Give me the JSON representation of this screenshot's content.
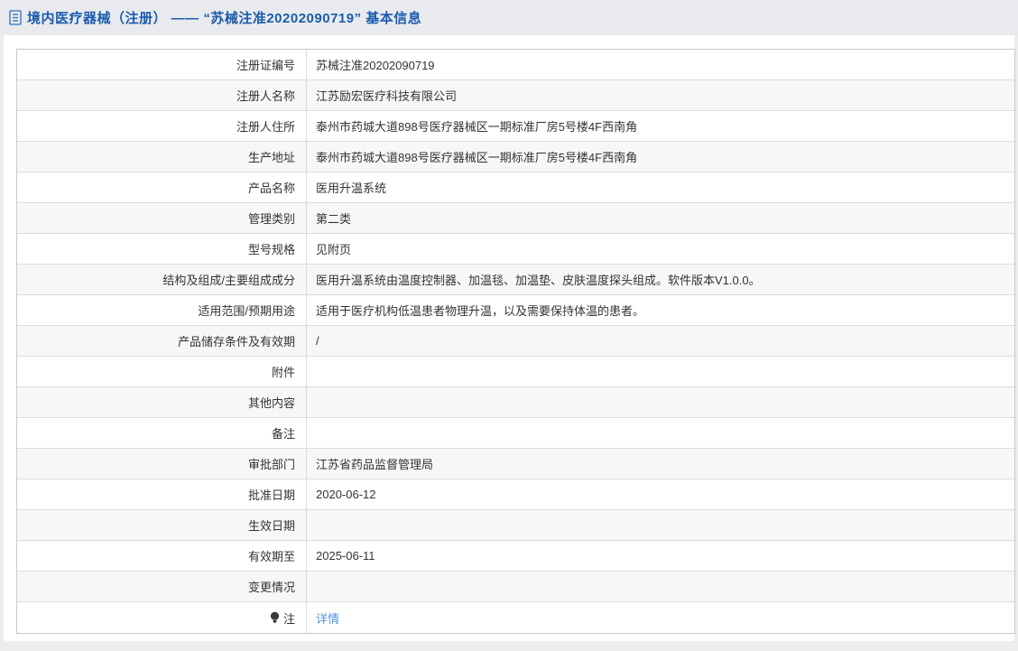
{
  "header": {
    "icon": "document-icon",
    "title": "境内医疗器械（注册） —— “苏械注准20202090719” 基本信息"
  },
  "table": {
    "rows": [
      {
        "label": "注册证编号",
        "value": "苏械注准20202090719"
      },
      {
        "label": "注册人名称",
        "value": "江苏励宏医疗科技有限公司"
      },
      {
        "label": "注册人住所",
        "value": "泰州市药城大道898号医疗器械区一期标准厂房5号楼4F西南角"
      },
      {
        "label": "生产地址",
        "value": "泰州市药城大道898号医疗器械区一期标准厂房5号楼4F西南角"
      },
      {
        "label": "产品名称",
        "value": "医用升温系统"
      },
      {
        "label": "管理类别",
        "value": "第二类"
      },
      {
        "label": "型号规格",
        "value": "见附页"
      },
      {
        "label": "结构及组成/主要组成成分",
        "value": "医用升温系统由温度控制器、加温毯、加温垫、皮肤温度探头组成。软件版本V1.0.0。"
      },
      {
        "label": "适用范围/预期用途",
        "value": "适用于医疗机构低温患者物理升温，以及需要保持体温的患者。"
      },
      {
        "label": "产品储存条件及有效期",
        "value": "/"
      },
      {
        "label": "附件",
        "value": ""
      },
      {
        "label": "其他内容",
        "value": ""
      },
      {
        "label": "备注",
        "value": ""
      },
      {
        "label": "审批部门",
        "value": "江苏省药品监督管理局"
      },
      {
        "label": "批准日期",
        "value": "2020-06-12"
      },
      {
        "label": "生效日期",
        "value": ""
      },
      {
        "label": "有效期至",
        "value": "2025-06-11"
      },
      {
        "label": "变更情况",
        "value": ""
      },
      {
        "label": "注",
        "value": "详情",
        "label_icon": "bulb-icon",
        "value_link": true
      }
    ]
  },
  "colors": {
    "title_blue": "#1b5bad",
    "link_blue": "#4f94e0",
    "row_stripe": "#f7f7f7",
    "border_gray": "#dcdcdc",
    "page_bg": "#ecedef"
  }
}
